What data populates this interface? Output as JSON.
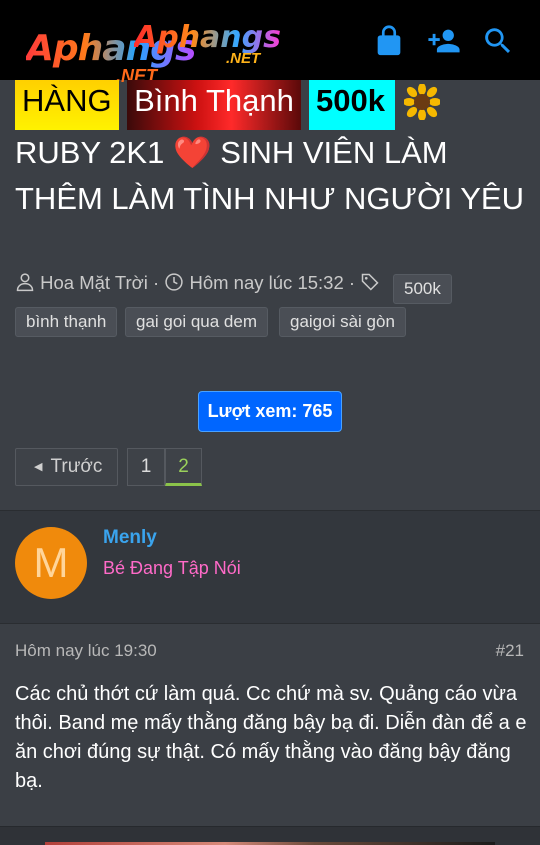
{
  "header": {
    "logo_text_1": "Aphangs",
    "logo_text_2": "Aphangs",
    "logo_net_1": ".NET",
    "logo_net_2": ".NET",
    "icons": [
      "lock-icon",
      "add-user-icon",
      "search-icon"
    ]
  },
  "thread": {
    "prefixes": [
      {
        "label": "HÀNG",
        "color": "#ffe600"
      },
      {
        "label": "Bình Thạnh",
        "color": "#d41a1a"
      },
      {
        "label": "500k",
        "color": "#00ffff"
      }
    ],
    "title_line": "RUBY 2K1",
    "title_emoji": "❤️",
    "title_rest": "SINH VIÊN LÀM THÊM LÀM TÌNH NHƯ NGƯỜI YÊU",
    "author": "Hoa Mặt Trời",
    "date": "Hôm nay lúc 15:32",
    "tags": [
      "500k",
      "bình thạnh",
      "gai goi qua dem",
      "gaigoi sài gòn"
    ],
    "views_label": "Lượt xem: 765"
  },
  "pagination": {
    "prev_label": "Trước",
    "pages": [
      "1",
      "2"
    ],
    "current": "2"
  },
  "post": {
    "avatar_letter": "M",
    "username": "Menly",
    "user_title": "Bé Đang Tập Nói",
    "time": "Hôm nay lúc 19:30",
    "number": "#21",
    "body": "Các chủ thớt cứ làm quá. Cc chứ mà sv. Quảng cáo vừa thôi. Band mẹ mấy thằng đăng bậy bạ đi. Diễn đàn để a e ăn chơi đúng sự thật. Có mấy thằng vào đăng bậy đăng bạ."
  },
  "colors": {
    "header_bg": "#000000",
    "page_bg": "#3b3f45",
    "link_blue": "#3aa4ee",
    "user_title_pink": "#ff6ac8",
    "views_bg": "#0066ff",
    "current_page": "#8bc34a"
  }
}
